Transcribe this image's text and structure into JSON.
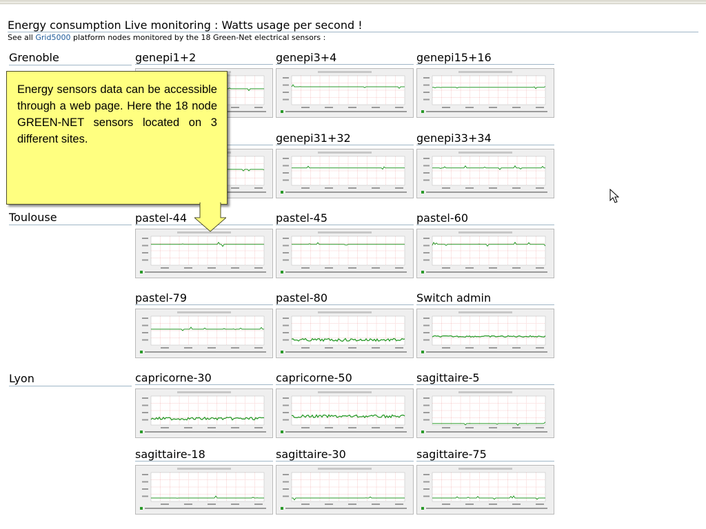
{
  "page": {
    "title": "Energy consumption Live monitoring : Watts usage per second !",
    "subtitle_pre": "See all ",
    "subtitle_link": "Grid5000",
    "subtitle_post": " platform nodes monitored by the 18 Green-Net electrical sensors :"
  },
  "callout": {
    "text": "Energy sensors data can be accessible through a web page. Here the 18 node GREEN-NET sensors located on 3 different sites."
  },
  "sites": {
    "grenoble": "Grenoble",
    "toulouse": "Toulouse",
    "lyon": "Lyon"
  },
  "nodes": {
    "genepi1_2": "genepi1+2",
    "genepi3_4": "genepi3+4",
    "genepi15_16": "genepi15+16",
    "genepi31_32": "genepi31+32",
    "genepi33_34": "genepi33+34",
    "pastel44": "pastel-44",
    "pastel45": "pastel-45",
    "pastel60": "pastel-60",
    "pastel79": "pastel-79",
    "pastel80": "pastel-80",
    "switch_admin": "Switch admin",
    "capricorne30": "capricorne-30",
    "capricorne50": "capricorne-50",
    "sagittaire5": "sagittaire-5",
    "sagittaire18": "sagittaire-18",
    "sagittaire30": "sagittaire-30",
    "sagittaire75": "sagittaire-75"
  },
  "colors": {
    "series": "#2a9a2a",
    "grid": "#f0a0a0",
    "rule": "#9fb6c7",
    "callout_bg": "#ffff80",
    "link": "#1d5a9a"
  },
  "graph_level": {
    "genepi_hidden_a": 0.55,
    "genepi_hidden_b": 0.55,
    "genepi3_4": 0.62,
    "genepi15_16": 0.6,
    "genepi31_32": 0.6,
    "genepi33_34": 0.6,
    "pastel44": 0.72,
    "pastel45": 0.72,
    "pastel60": 0.72,
    "pastel79": 0.55,
    "pastel80": 0.18,
    "switch_admin": 0.3,
    "capricorne30": 0.22,
    "capricorne50": 0.3,
    "sagittaire5": 0.05,
    "sagittaire18": 0.12,
    "sagittaire30": 0.12,
    "sagittaire75": 0.12
  },
  "graph_noise": {
    "pastel80": 1,
    "switch_admin": 0.5,
    "capricorne30": 1,
    "capricorne50": 1
  },
  "graph_icon": "energy-consumption-graph"
}
